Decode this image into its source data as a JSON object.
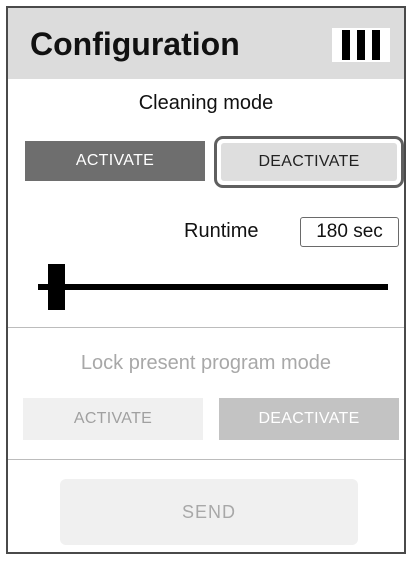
{
  "header": {
    "title": "Configuration",
    "menu_icon": "menu-bars-icon"
  },
  "cleaning_mode": {
    "title": "Cleaning mode",
    "activate_label": "ACTIVATE",
    "deactivate_label": "DEACTIVATE",
    "selected": "DEACTIVATE"
  },
  "runtime": {
    "label": "Runtime",
    "value": "180 sec",
    "slider_level": 0.03
  },
  "lock_mode": {
    "title": "Lock present program mode",
    "activate_label": "ACTIVATE",
    "deactivate_label": "DEACTIVATE",
    "enabled": false
  },
  "send": {
    "label": "SEND",
    "enabled": false
  },
  "colors": {
    "header_bg": "#dcdcdc",
    "active_button": "#6e6e6e",
    "selected_border": "#5f5f5f",
    "disabled_text": "#a8a8a8"
  }
}
